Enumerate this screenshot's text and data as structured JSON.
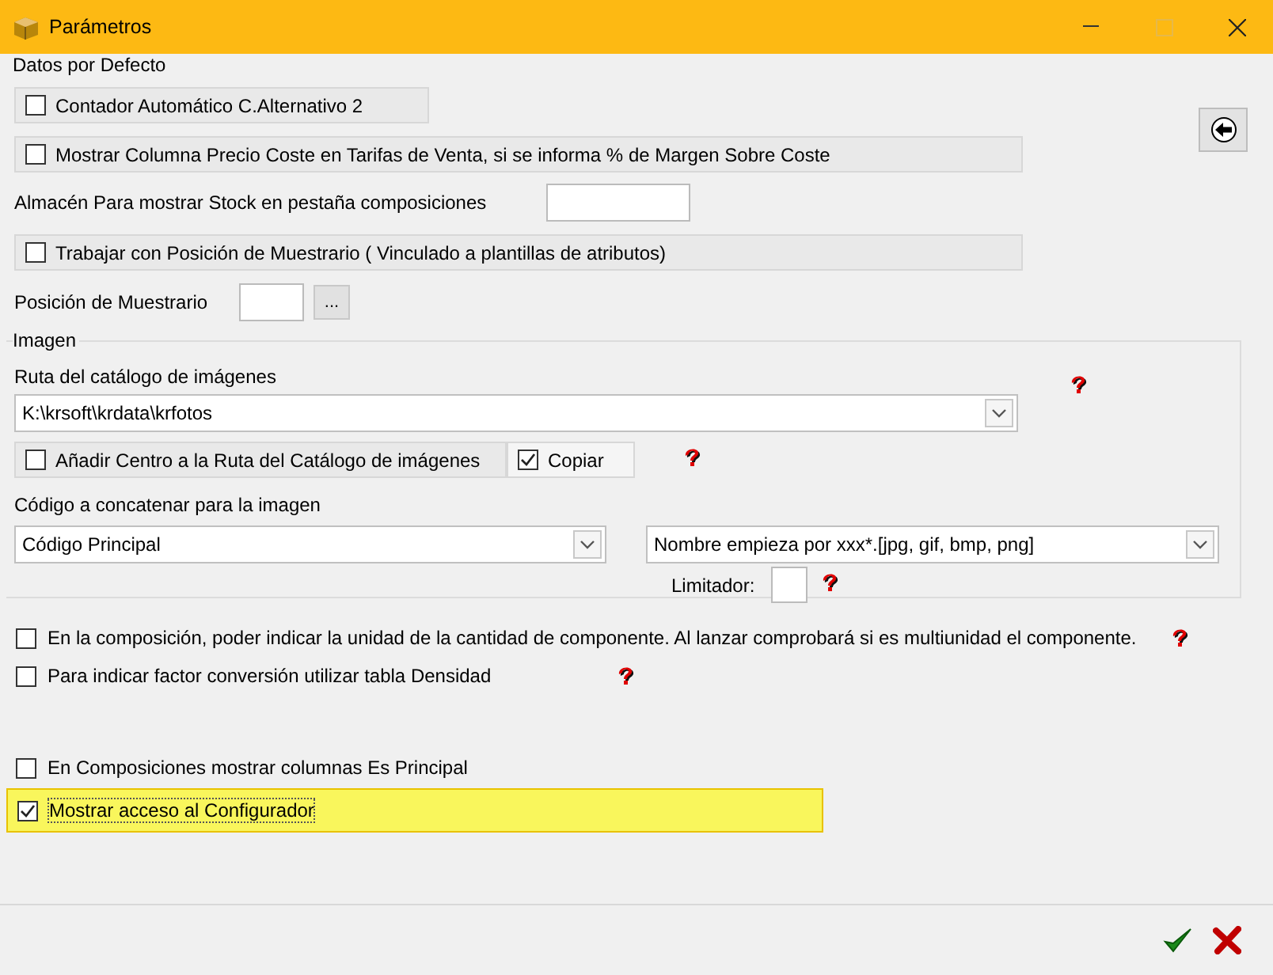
{
  "window": {
    "title": "Parámetros",
    "maximize_disabled": true
  },
  "defaults": {
    "legend": "Datos por Defecto",
    "items": [
      {
        "kind": "checkbox",
        "label": "Contador Automático C.Alternativo 2",
        "checked": false
      },
      {
        "kind": "checkbox",
        "label": "Mostrar Columna Precio Coste en Tarifas de Venta, si se informa % de Margen Sobre Coste",
        "checked": false
      },
      {
        "kind": "field",
        "label": "Almacén Para mostrar Stock en pestaña composiciones"
      },
      {
        "kind": "checkbox",
        "label": "Trabajar con Posición de Muestrario ( Vinculado a plantillas de atributos)",
        "checked": false
      },
      {
        "kind": "lookup",
        "label": "Posición de Muestrario",
        "button_label": "..."
      }
    ]
  },
  "image": {
    "legend": "Imagen",
    "path_label": "Ruta del catálogo de imágenes",
    "path_value": "K:\\krsoft\\krdata\\krfotos",
    "add_centre": {
      "label": "Añadir Centro a la Ruta del Catálogo de imágenes",
      "checked": false
    },
    "copy": {
      "label": "Copiar",
      "checked": true
    },
    "code_label": "Código a concatenar para la imagen",
    "code_value": "Código Principal",
    "name_value": "Nombre empieza por xxx*.[jpg, gif, bmp, png]",
    "limiter_label": "Limitador:"
  },
  "options": [
    {
      "label": "En la composición, poder indicar la unidad de la cantidad de componente. Al lanzar comprobará si es multiunidad el componente.",
      "checked": false,
      "highlighted": false,
      "help": true
    },
    {
      "label": "Para indicar factor conversión utilizar tabla Densidad",
      "checked": false,
      "highlighted": false,
      "help": true
    },
    {
      "label": "En Composiciones mostrar columnas Es Principal",
      "checked": false,
      "highlighted": false,
      "help": false
    },
    {
      "label": "Mostrar acceso al Configurador",
      "checked": true,
      "highlighted": true,
      "help": false
    }
  ]
}
